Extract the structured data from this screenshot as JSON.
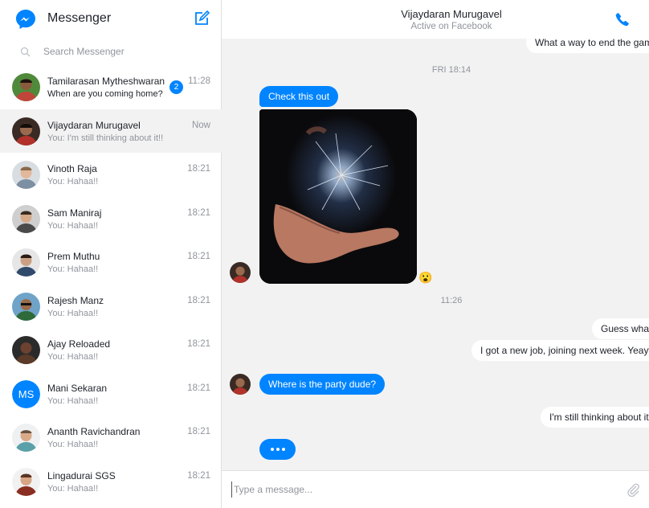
{
  "app": {
    "title": "Messenger",
    "accent": "#0084ff"
  },
  "search": {
    "placeholder": "Search Messenger",
    "value": ""
  },
  "conversations": [
    {
      "name": "Tamilarasan Mytheshwaran",
      "preview": "When are you coming home?",
      "time": "11:28",
      "unread_count": "2",
      "avatar": "avatar-photo"
    },
    {
      "name": "Vijaydaran Murugavel",
      "preview": "You: I'm still thinking about it!!",
      "time": "Now",
      "avatar": "avatar-photo"
    },
    {
      "name": "Vinoth Raja",
      "preview": "You: Hahaa!!",
      "time": "18:21",
      "avatar": "avatar-photo"
    },
    {
      "name": "Sam Maniraj",
      "preview": "You: Hahaa!!",
      "time": "18:21",
      "avatar": "avatar-photo"
    },
    {
      "name": "Prem Muthu",
      "preview": "You: Hahaa!!",
      "time": "18:21",
      "avatar": "avatar-photo"
    },
    {
      "name": "Rajesh Manz",
      "preview": "You: Hahaa!!",
      "time": "18:21",
      "avatar": "avatar-photo"
    },
    {
      "name": "Ajay Reloaded",
      "preview": "You: Hahaa!!",
      "time": "18:21",
      "avatar": "avatar-photo"
    },
    {
      "name": "Mani Sekaran",
      "preview": "You: Hahaa!!",
      "time": "18:21",
      "initials": "MS"
    },
    {
      "name": "Ananth Ravichandran",
      "preview": "You: Hahaa!!",
      "time": "18:21",
      "avatar": "avatar-photo"
    },
    {
      "name": "Lingadurai SGS",
      "preview": "You: Hahaa!!",
      "time": "18:21",
      "avatar": "avatar-photo"
    }
  ],
  "chat": {
    "contact_name": "Vijaydaran Murugavel",
    "contact_status": "Active on Facebook",
    "messages": {
      "m0": "What a way to end the game",
      "ts1": "FRI 18:14",
      "m1": "Check this out",
      "reaction": "😮",
      "ts2": "11:26",
      "m2": "Guess what",
      "m3": "I got a new job, joining next week. Yeayyy",
      "m4": "Where is the party dude?",
      "m5": "I'm still thinking about it!!"
    },
    "composer_placeholder": "Type a message...",
    "composer_value": ""
  }
}
